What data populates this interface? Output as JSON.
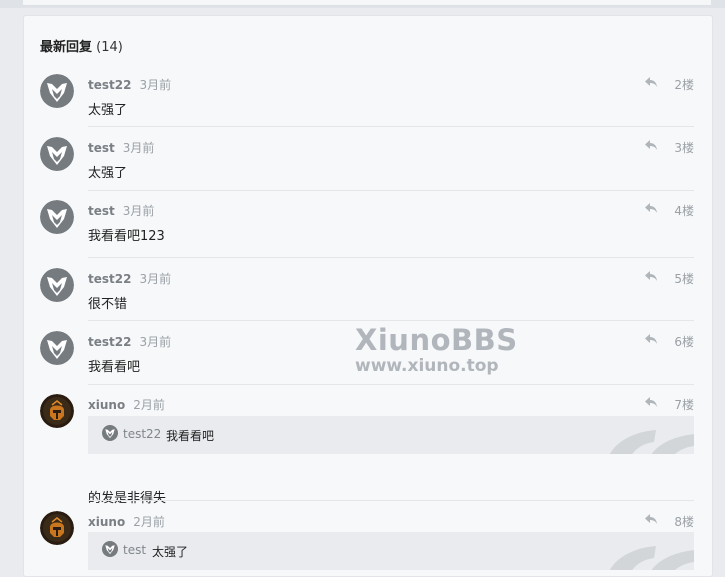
{
  "header": {
    "title": "最新回复",
    "count": "(14)"
  },
  "posts": [
    {
      "user": "test22",
      "time": "3月前",
      "floor": "2楼",
      "content": "太强了"
    },
    {
      "user": "test",
      "time": "3月前",
      "floor": "3楼",
      "content": "太强了"
    },
    {
      "user": "test",
      "time": "3月前",
      "floor": "4楼",
      "content": "我看看吧123"
    },
    {
      "user": "test22",
      "time": "3月前",
      "floor": "5楼",
      "content": "很不错"
    },
    {
      "user": "test22",
      "time": "3月前",
      "floor": "6楼",
      "content": "我看看吧"
    },
    {
      "user": "xiuno",
      "time": "2月前",
      "floor": "7楼",
      "quote_user": "test22",
      "quote_text": "我看看吧",
      "content": "的发是非得失"
    },
    {
      "user": "xiuno",
      "time": "2月前",
      "floor": "8楼",
      "quote_user": "test",
      "quote_text": "太强了"
    }
  ],
  "watermark": {
    "line1": "XiunoBBS",
    "line2": "www.xiuno.top"
  },
  "colors": {
    "avatar_gray": "#767b80",
    "avatar_dark": "#3a2a18",
    "quote_bg": "#e9ebee"
  }
}
